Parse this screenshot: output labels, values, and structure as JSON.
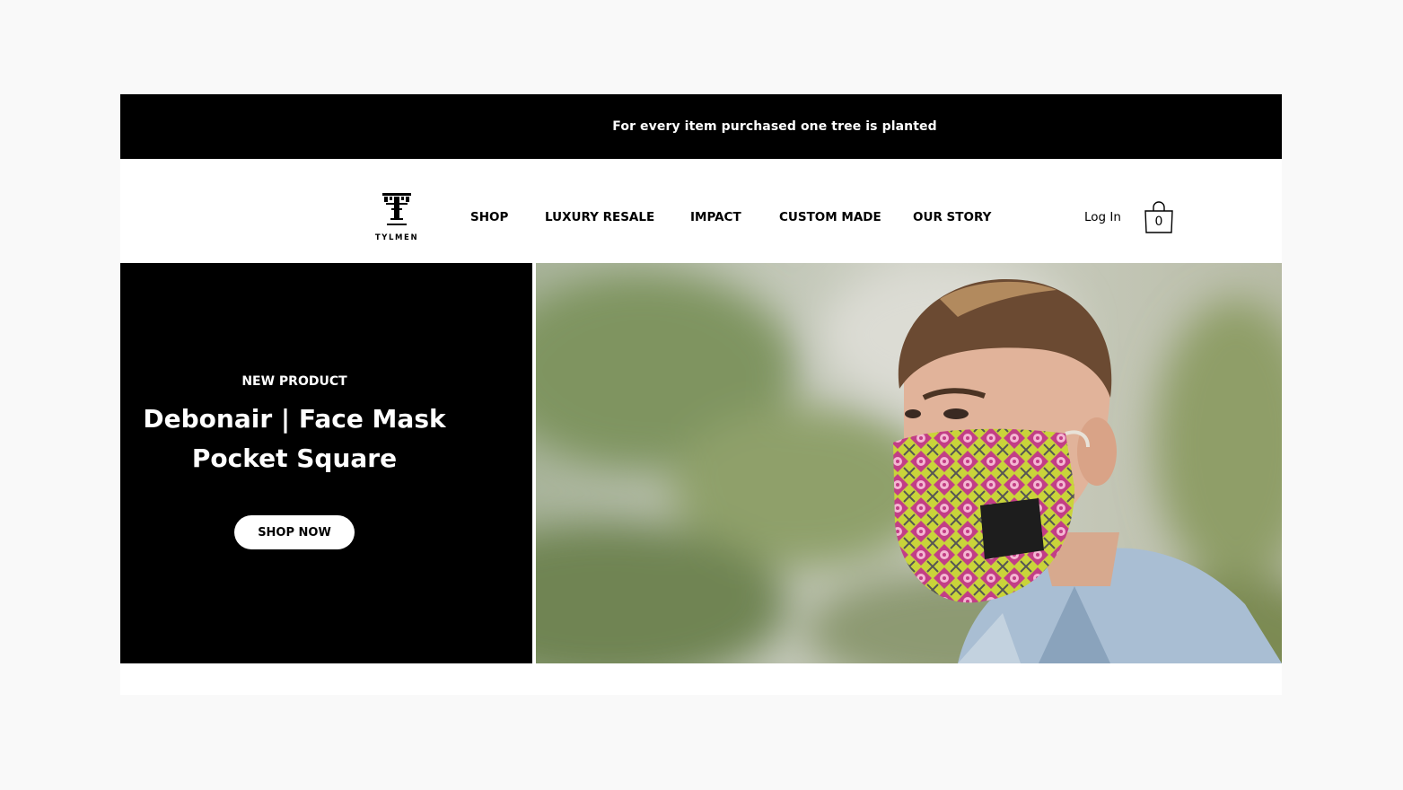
{
  "announcement": {
    "text": "For every item purchased one tree is planted"
  },
  "brand": {
    "name": "TYLMEN"
  },
  "nav": {
    "items": [
      {
        "label": "SHOP"
      },
      {
        "label": "LUXURY RESALE"
      },
      {
        "label": "IMPACT"
      },
      {
        "label": "CUSTOM MADE"
      },
      {
        "label": "OUR STORY"
      }
    ]
  },
  "account": {
    "login_label": "Log In"
  },
  "cart": {
    "count": "0",
    "icon": "shopping-bag-icon"
  },
  "hero": {
    "eyebrow": "NEW PRODUCT",
    "title_line1": "Debonair | Face Mask",
    "title_line2": "Pocket Square",
    "cta_label": "SHOP NOW",
    "image_subject": "man wearing patterned face mask"
  },
  "colors": {
    "bar_bg": "#000000",
    "hero_left_bg": "#000000",
    "button_bg": "#ffffff",
    "page_bg": "#f9f9f9"
  }
}
